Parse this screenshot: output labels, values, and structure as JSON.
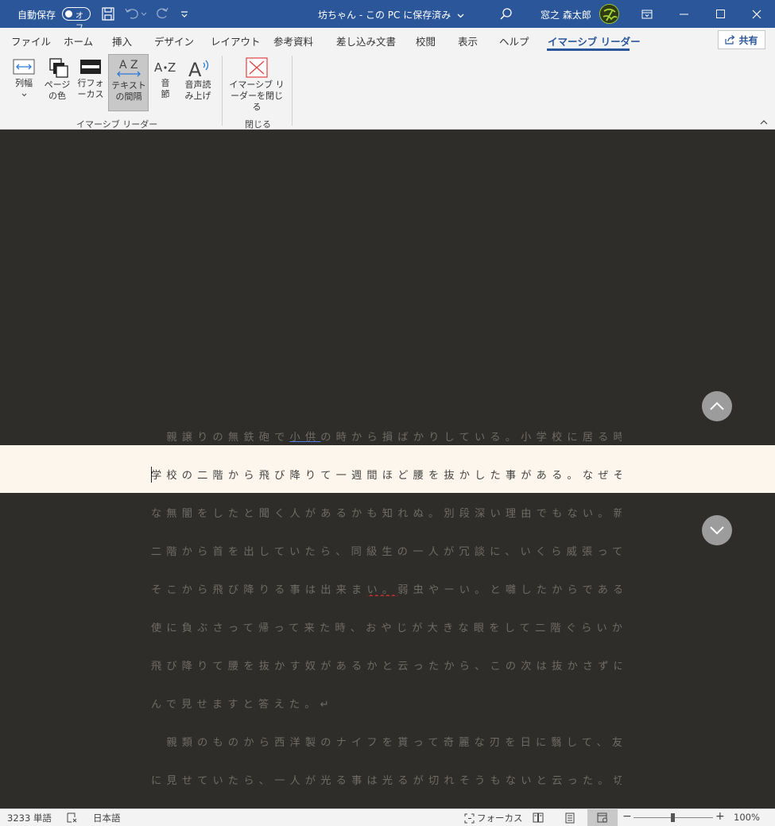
{
  "titlebar": {
    "autosave_label": "自動保存",
    "autosave_state": "オフ",
    "undo_icon": "undo-icon",
    "document_title": "坊ちゃん - この PC に保存済み",
    "user_name": "窓之 森太郎",
    "avatar_text": "杜"
  },
  "tabs": [
    {
      "label": "ファイル"
    },
    {
      "label": "ホーム"
    },
    {
      "label": "挿入"
    },
    {
      "label": "デザイン"
    },
    {
      "label": "レイアウト"
    },
    {
      "label": "参考資料"
    },
    {
      "label": "差し込み文書"
    },
    {
      "label": "校閲"
    },
    {
      "label": "表示"
    },
    {
      "label": "ヘルプ"
    },
    {
      "label": "イマーシブ リーダー"
    }
  ],
  "share_label": "共有",
  "ribbon": {
    "column_width": "列幅",
    "page_color": "ページの色",
    "line_focus": "行フォーカス",
    "text_spacing": "テキストの間隔",
    "syllables": "音節",
    "read_aloud": "音声読み上げ",
    "close_reader": "イマーシブ リーダーを閉じる",
    "group_reader": "イマーシブ リーダー",
    "group_close": "閉じる"
  },
  "document": {
    "lines": [
      "　親譲りの無鉄砲で小供の時から損ばかりしている。小学校に居る時分",
      "学校の二階から飛び降りて一週間ほど腰を抜かした事がある。なぜそん",
      "な無闇をしたと聞く人があるかも知れぬ。別段深い理由でもない。新築の",
      "二階から首を出していたら、同級生の一人が冗談に、いくら威張っても、",
      "そこから飛び降りる事は出来まい。弱虫やーい。と囃したからである。小",
      "使に負ぶさって帰って来た時、おやじが大きな眼をして二階ぐらいから",
      "飛び降りて腰を抜かす奴があるかと云ったから、この次は抜かさずに飛",
      "んで見せますと答えた。↵",
      "　親類のものから西洋製のナイフを貰って奇麗な刃を日に翳して、友達",
      "に見せていたら、一人が光る事は光るが切れそうもないと云った。切れぬ"
    ]
  },
  "status": {
    "word_count": "3233 単語",
    "language": "日本語",
    "focus_label": "フォーカス",
    "zoom_minus": "−",
    "zoom_plus": "+",
    "zoom_level": "100%",
    "zoom_percent": 100
  },
  "colors": {
    "accent": "#2b579a",
    "document_bg": "#2f2d2a",
    "focus_band": "#fcf6ec"
  }
}
